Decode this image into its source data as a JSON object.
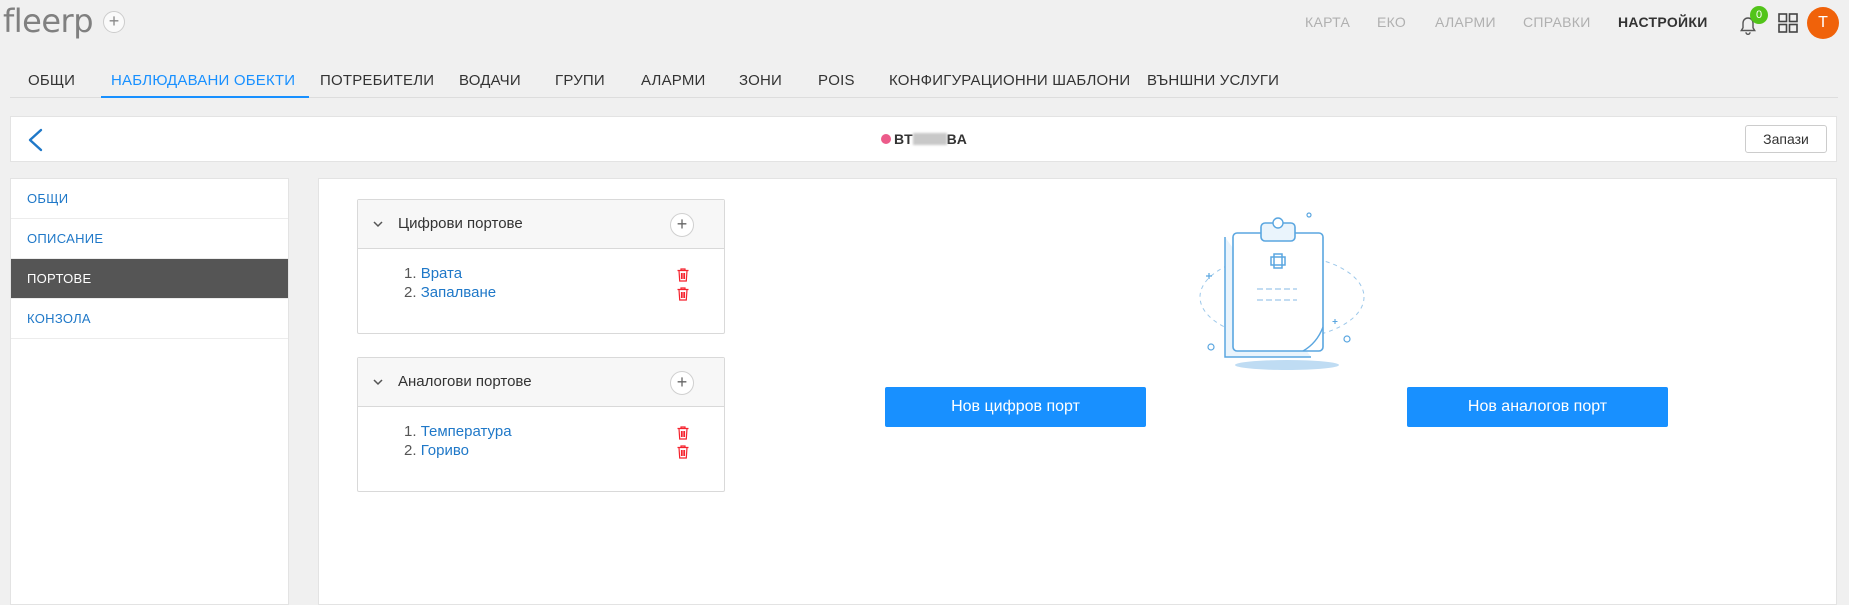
{
  "app": {
    "logo": "fleerp",
    "logo_plus": "+"
  },
  "topnav": [
    {
      "label": "КАРТА"
    },
    {
      "label": "ЕКО"
    },
    {
      "label": "АЛАРМИ"
    },
    {
      "label": "СПРАВКИ"
    },
    {
      "label": "НАСТРОЙКИ",
      "active": true
    }
  ],
  "notifications": {
    "count": "0"
  },
  "user": {
    "initial": "T",
    "avatar_color": "#f0620a"
  },
  "tabs": [
    {
      "label": "ОБЩИ"
    },
    {
      "label": "НАБЛЮДАВАНИ ОБЕКТИ",
      "active": true
    },
    {
      "label": "ПОТРЕБИТЕЛИ"
    },
    {
      "label": "ВОДАЧИ"
    },
    {
      "label": "ГРУПИ"
    },
    {
      "label": "АЛАРМИ"
    },
    {
      "label": "ЗОНИ"
    },
    {
      "label": "POIS"
    },
    {
      "label": "КОНФИГУРАЦИОННИ ШАБЛОНИ"
    },
    {
      "label": "ВЪНШНИ УСЛУГИ"
    }
  ],
  "header": {
    "vehicle_prefix": "BT",
    "vehicle_suffix": "BA",
    "status_color": "#ec5b8a",
    "save_label": "Запази"
  },
  "leftmenu": [
    {
      "label": "ОБЩИ"
    },
    {
      "label": "ОПИСАНИЕ"
    },
    {
      "label": "ПОРТОВЕ",
      "active": true
    },
    {
      "label": "КОНЗОЛА"
    }
  ],
  "digital_ports": {
    "title": "Цифрови портове",
    "items": [
      {
        "num": "1.",
        "name": "Врата"
      },
      {
        "num": "2.",
        "name": "Запалване"
      }
    ]
  },
  "analog_ports": {
    "title": "Аналогови портове",
    "items": [
      {
        "num": "1.",
        "name": "Температура"
      },
      {
        "num": "2.",
        "name": "Гориво"
      }
    ]
  },
  "actions": {
    "new_digital": "Нов цифров порт",
    "new_analog": "Нов аналогов порт"
  },
  "colors": {
    "accent": "#1890ff",
    "active_menu_bg": "#555555",
    "delete": "#f5222d",
    "badge": "#52c41a"
  }
}
